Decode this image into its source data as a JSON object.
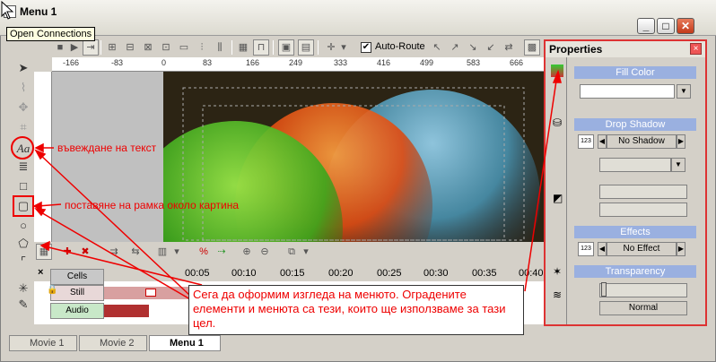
{
  "window": {
    "title": "Menu 1"
  },
  "tooltip": "Open Connections",
  "toolbar": {
    "auto_route_label": "Auto-Route",
    "auto_route_checked": true
  },
  "ruler": {
    "ticks": [
      "-166",
      "-83",
      "0",
      "83",
      "166",
      "249",
      "333",
      "416",
      "499",
      "583",
      "666"
    ]
  },
  "timeline": {
    "buttons": [
      "Cells",
      "Still",
      "Audio"
    ],
    "times": [
      "00:05",
      "00:10",
      "00:15",
      "00:20",
      "00:25",
      "00:30",
      "00:35",
      "00:40"
    ]
  },
  "tabs": [
    "Movie 1",
    "Movie 2",
    "Menu 1"
  ],
  "properties": {
    "title": "Properties",
    "fill_color": "Fill Color",
    "drop_shadow": "Drop Shadow",
    "drop_shadow_value": "No Shadow",
    "drop_shadow_num": "123",
    "effects": "Effects",
    "effects_value": "No Effect",
    "effects_num": "123",
    "transparency": "Transparency",
    "transparency_mode": "Normal"
  },
  "annotations": {
    "text_tool": "въвеждане на текст",
    "frame_tool": "поставяне на рамка около картина",
    "callout": "Сега да оформим изгледа на менюто. Оградените елементи и менюта са тези, които ще използваме за тази цел."
  },
  "colors": {
    "annotation": "#e00000",
    "section_header": "#9ab0e0"
  }
}
